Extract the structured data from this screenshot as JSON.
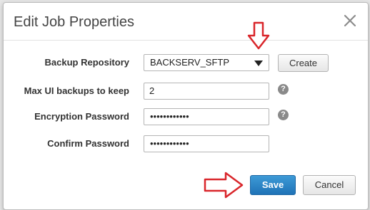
{
  "dialog": {
    "title": "Edit Job Properties",
    "close_icon": "close-icon"
  },
  "form": {
    "backup_repository": {
      "label": "Backup Repository",
      "value": "BACKSERV_SFTP",
      "dropdown_icon": "chevron-down-icon",
      "create_label": "Create"
    },
    "max_backups": {
      "label": "Max UI backups to keep",
      "value": "2",
      "help_icon": "help-icon",
      "help_text": "?"
    },
    "encryption_password": {
      "label": "Encryption Password",
      "value": "••••••••••••",
      "help_icon": "help-icon",
      "help_text": "?"
    },
    "confirm_password": {
      "label": "Confirm Password",
      "value": "••••••••••••"
    }
  },
  "footer": {
    "save_label": "Save",
    "cancel_label": "Cancel"
  },
  "annotations": {
    "arrow_color": "#d9262b",
    "down_arrow_icon": "down-arrow-icon",
    "right_arrow_icon": "right-arrow-icon"
  }
}
